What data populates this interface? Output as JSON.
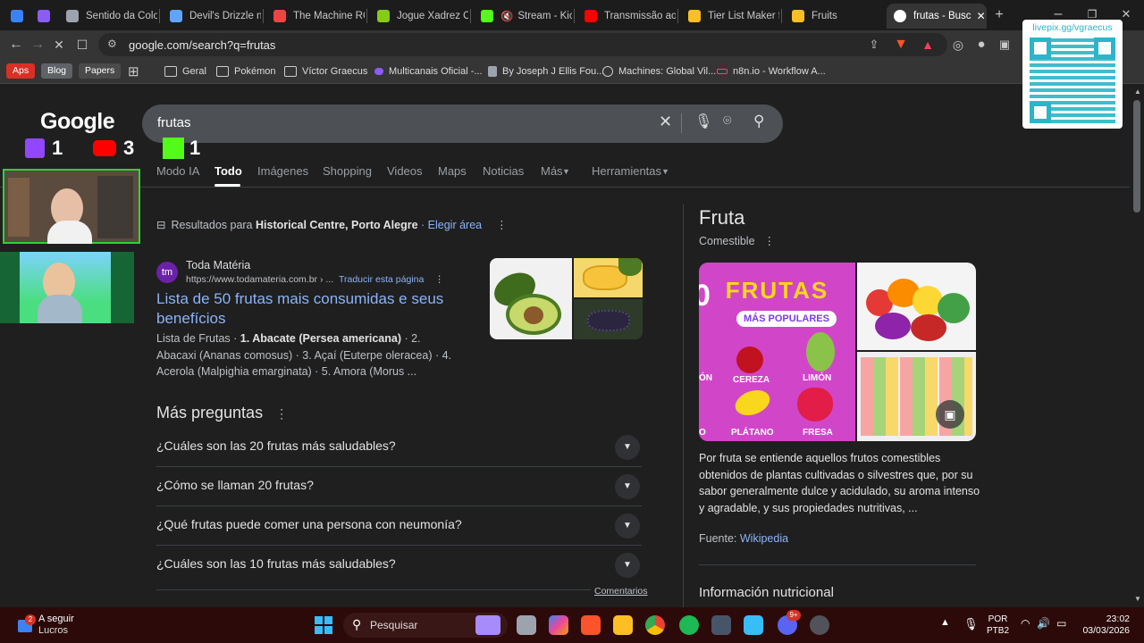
{
  "tabs": [
    {
      "label": "",
      "color": "#3b82f6"
    },
    {
      "label": "",
      "color": "#8b5cf6"
    },
    {
      "label": "Sentido da Color",
      "color": "#9ca3af"
    },
    {
      "label": "Devil's Drizzle no",
      "color": "#60a5fa"
    },
    {
      "label": "The Machine RO",
      "color": "#ef4444"
    },
    {
      "label": "Jogue Xadrez Or",
      "color": "#84cc16"
    },
    {
      "label": "Stream - Kick",
      "color": "#53fc18"
    },
    {
      "label": "Transmissão ao v",
      "color": "#ff0000"
    },
    {
      "label": "Tier List Maker fo",
      "color": "#fbbf24"
    },
    {
      "label": "Fruits",
      "color": "#fbbf24"
    },
    {
      "label": "frutas - Busc",
      "color": "#ffffff"
    }
  ],
  "address": {
    "url": "google.com/search?q=frutas"
  },
  "bookmarks": {
    "chips": [
      {
        "label": "Aps",
        "bg": "#d93025"
      },
      {
        "label": "Blog",
        "bg": "#5f6368"
      },
      {
        "label": "Papers",
        "bg": "#4a4a4a"
      }
    ],
    "items": [
      "Geral",
      "Pokémon",
      "Víctor Graecus",
      "Multicanais Oficial -...",
      "By Joseph J Ellis Fou...",
      "Machines: Global Vil...",
      "n8n.io - Workflow A..."
    ]
  },
  "google": {
    "logo": "Google",
    "query": "frutas",
    "tabs": [
      "Modo IA",
      "Todo",
      "Imágenes",
      "Shopping",
      "Videos",
      "Maps",
      "Noticias",
      "Más",
      "Herramientas"
    ],
    "location": {
      "prefix": "Resultados para",
      "place": "Historical Centre, Porto Alegre",
      "action": "· Elegir área"
    },
    "result": {
      "site": "Toda Matéria",
      "badge": "tm",
      "url": "https://www.todamateria.com.br › ...",
      "translate": "Traducir esta página",
      "title": "Lista de 50 frutas mais consumidas e seus benefícios",
      "snippet_pre": "Lista de Frutas · ",
      "snippet_bold": "1. Abacate (Persea americana)",
      "snippet_post": " · 2. Abacaxi (Ananas comosus) · 3. Açaí (Euterpe oleracea) · 4. Acerola (Malpighia emarginata) · 5. Amora (Morus ..."
    },
    "paa": {
      "heading": "Más preguntas",
      "questions": [
        "¿Cuáles son las 20 frutas más saludables?",
        "¿Cómo se llaman 20 frutas?",
        "¿Qué frutas puede comer una persona con neumonía?",
        "¿Cuáles son las 10 frutas más saludables?"
      ],
      "comments": "Comentarios"
    },
    "knowledge": {
      "title": "Fruta",
      "subtitle": "Comestible",
      "image_text": {
        "header": "FRUTAS",
        "sub": "MÁS POPULARES",
        "left_num": "0",
        "labels": [
          "CEREZA",
          "LIMÓN",
          "PLÁTANO",
          "FRESA",
          "ÓN",
          "O"
        ]
      },
      "description": "Por fruta se entiende aquellos frutos comestibles obtenidos de plantas cultivadas o silvestres que, por su sabor generalmente dulce y acidulado, su aroma intenso y agradable, y sus propiedades nutritivas, ...",
      "source_label": "Fuente:",
      "source_link": "Wikipedia",
      "nutrition": "Información nutricional"
    }
  },
  "stream_overlay": {
    "twitch_count": "1",
    "youtube_count": "3",
    "kick_count": "1",
    "qr_label": "livepix.gg/vgraecus"
  },
  "taskbar": {
    "weather_title": "A seguir",
    "weather_sub": "Lucros",
    "weather_badge": "2",
    "search_label": "Pesquisar",
    "lang1": "POR",
    "lang2": "PTB2",
    "time": "23:02",
    "date": "03/03/2026",
    "notif_badge": "9+"
  }
}
